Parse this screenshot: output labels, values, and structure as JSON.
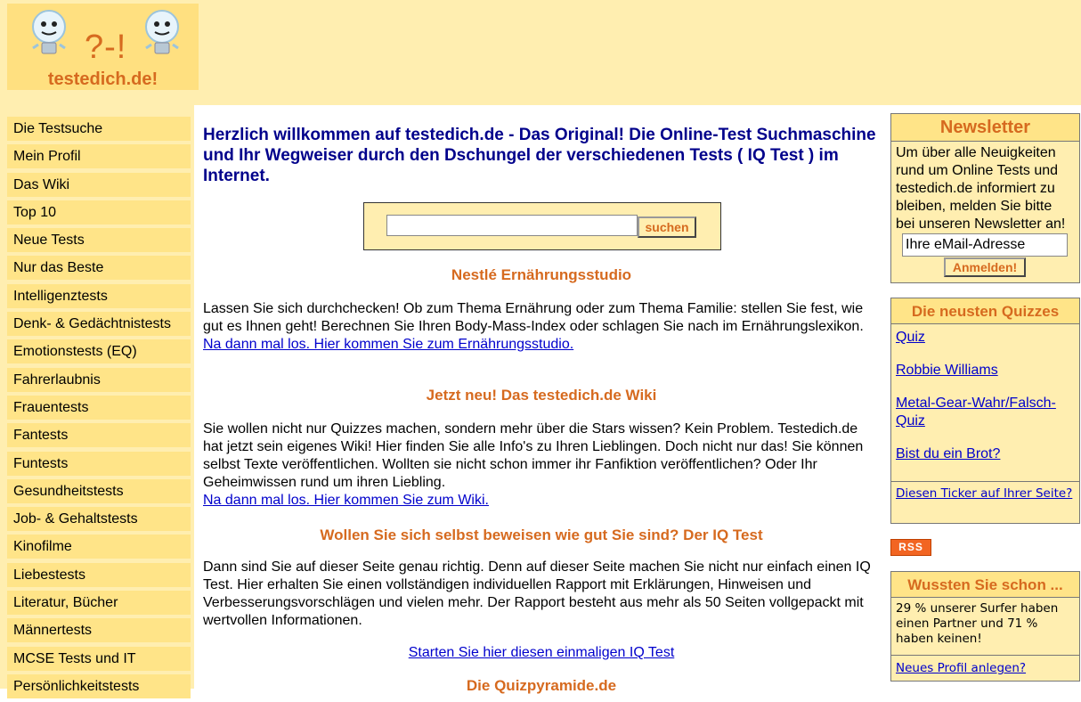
{
  "header": {
    "logo_glyph": "?-!",
    "logo_text": "testedich.de!"
  },
  "nav": [
    "Die Testsuche",
    "Mein Profil",
    "Das Wiki",
    "Top 10",
    "Neue Tests",
    "Nur das Beste",
    "Intelligenztests",
    "Denk- & Gedächtnistests",
    "Emotionstests (EQ)",
    "Fahrerlaubnis",
    "Frauentests",
    "Fantests",
    "Funtests",
    "Gesundheitstests",
    "Job- & Gehaltstests",
    "Kinofilme",
    "Liebestests",
    "Literatur, Bücher",
    "Männertests",
    "MCSE Tests und IT",
    "Persönlichkeitstests"
  ],
  "main": {
    "welcome": "Herzlich willkommen auf testedich.de - Das Original! Die Online-Test Suchmaschine und Ihr Wegweiser durch den Dschungel der verschiedenen Tests ( IQ Test ) im Internet.",
    "search": {
      "value": "",
      "button": "suchen"
    },
    "sections": [
      {
        "title": "Nestlé Ernährungsstudio",
        "body": "Lassen Sie sich durchchecken! Ob zum Thema Ernährung oder zum Thema Familie: stellen Sie fest, wie gut es Ihnen geht! Berechnen Sie Ihren Body-Mass-Index oder schlagen Sie nach im Ernährungslexikon.",
        "link": "Na dann mal los. Hier kommen Sie zum Ernährungsstudio."
      },
      {
        "title": "Jetzt neu! Das testedich.de Wiki",
        "body": "Sie wollen nicht nur Quizzes machen, sondern mehr über die Stars wissen? Kein Problem. Testedich.de hat jetzt sein eigenes Wiki! Hier finden Sie alle Info's zu Ihren Lieblingen. Doch nicht nur das! Sie können selbst Texte veröffentlichen. Wollten sie nicht schon immer ihr Fanfiktion veröffentlichen? Oder Ihr Geheimwissen rund um ihren Liebling.",
        "link": "Na dann mal los. Hier kommen Sie zum Wiki."
      },
      {
        "title": "Wollen Sie sich selbst beweisen wie gut Sie sind? Der IQ Test",
        "body": "Dann sind Sie auf dieser Seite genau richtig. Denn auf dieser Seite machen Sie nicht nur einfach einen IQ Test. Hier erhalten Sie einen vollständigen individuellen Rapport mit Erklärungen, Hinweisen und Verbesserungsvorschlägen und vielen mehr. Der Rapport besteht aus mehr als 50 Seiten vollgepackt mit wertvollen Informationen.",
        "link": "Starten Sie hier diesen einmaligen IQ Test"
      },
      {
        "title": "Die Quizpyramide.de"
      }
    ]
  },
  "newsletter": {
    "title": "Newsletter",
    "text": "Um über alle Neuigkeiten rund um Online Tests und testedich.de informiert zu bleiben, melden Sie bitte bei unseren Newsletter an!",
    "email_value": "Ihre eMail-Adresse",
    "button": "Anmelden!"
  },
  "quizzes": {
    "title": "Die neusten Quizzes",
    "items": [
      "Quiz",
      "Robbie Williams",
      "Metal-Gear-Wahr/Falsch-Quiz",
      "Bist du ein Brot?"
    ],
    "ticker_link": "Diesen Ticker auf Ihrer Seite?"
  },
  "rss": "RSS",
  "facts": {
    "title": "Wussten Sie schon ...",
    "text": "29 % unserer Surfer haben einen Partner und 71 % haben keinen!",
    "link": "Neues Profil anlegen?"
  },
  "colors": {
    "accent": "#d66a1f",
    "panel": "#ffeeb0",
    "nav": "#ffe488",
    "heading": "#00008b",
    "link": "#0000cc"
  }
}
